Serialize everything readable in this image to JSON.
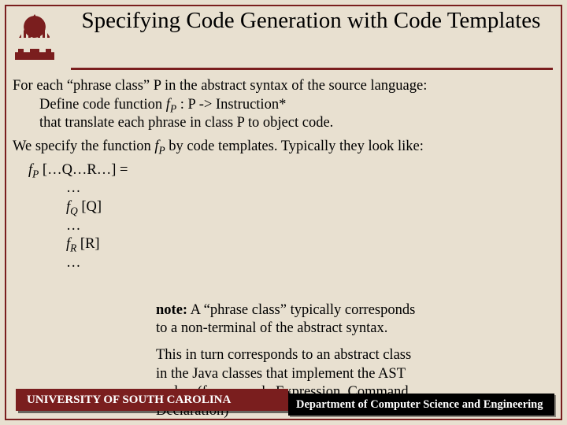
{
  "title": "Specifying Code Generation with Code Templates",
  "body": {
    "p1_lead": "For each “phrase class” P in the abstract syntax of the source language:",
    "p1_def_prefix": "Define code function ",
    "p1_def_fn_f": "f",
    "p1_def_fn_sub": "P",
    "p1_def_suffix": " : P -> Instruction*",
    "p1_line3": "that translate each phrase in class P to object code.",
    "p2_prefix": "We specify the function ",
    "p2_fn_f": "f",
    "p2_fn_sub": "P",
    "p2_suffix": " by code templates. Typically they look like:",
    "tmpl_head_f": "f",
    "tmpl_head_sub": "P",
    "tmpl_head_rest": " […Q…R…] =",
    "dots": "…",
    "fq_f": "f",
    "fq_sub": "Q",
    "fq_rest": " [Q]",
    "fr_f": "f",
    "fr_sub": "R",
    "fr_rest": " [R]"
  },
  "note": {
    "label": "note:",
    "p1": " A “phrase class” typically corresponds to a non-terminal of the abstract syntax.",
    "p2": "This in turn corresponds to an abstract class in the Java classes that implement the AST nodes. (for example Expression, Command, Declaration)"
  },
  "footer": {
    "left": "UNIVERSITY OF SOUTH CAROLINA",
    "right": "Department of Computer Science and Engineering"
  }
}
